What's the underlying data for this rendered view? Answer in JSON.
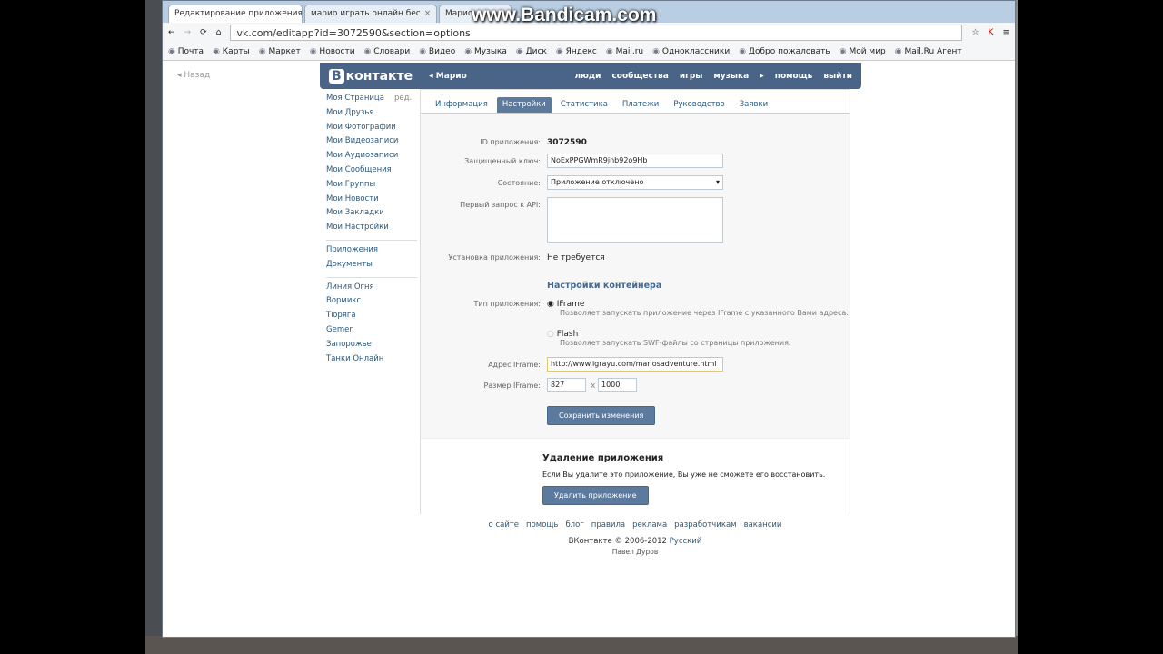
{
  "browser": {
    "tabs": [
      {
        "title": "Редактирование приложения",
        "icon": "vk-icon"
      },
      {
        "title": "марио играть онлайн бес",
        "icon": "loading-icon"
      },
      {
        "title": "Марио",
        "icon": "mario-icon"
      }
    ],
    "watermark": "www.Bandicam.com",
    "url": "vk.com/editapp?id=3072590&section=options",
    "bookmarks": [
      "Почта",
      "Карты",
      "Маркет",
      "Новости",
      "Словари",
      "Видео",
      "Музыка",
      "Диск",
      "Яндекс",
      "Mail.ru",
      "Одноклассники",
      "Добро пожаловать",
      "Мой мир",
      "Mail.Ru Агент"
    ]
  },
  "page": {
    "back": "Назад",
    "logo": "контакте",
    "logo_letter": "В",
    "user": "Марио",
    "nav": [
      "люди",
      "сообщества",
      "игры",
      "музыка",
      "▸",
      "помощь",
      "выйти"
    ],
    "sidebar": {
      "edit": "ред.",
      "group1": [
        "Моя Страница",
        "Мои Друзья",
        "Мои Фотографии",
        "Мои Видеозаписи",
        "Мои Аудиозаписи",
        "Мои Сообщения",
        "Мои Группы",
        "Мои Новости",
        "Мои Закладки",
        "Мои Настройки"
      ],
      "group2": [
        "Приложения",
        "Документы"
      ],
      "group3": [
        "Линия Огня",
        "Вормикс",
        "Тюряга",
        "Gemer",
        "Запорожье",
        "Танки Онлайн"
      ]
    },
    "tabs": [
      "Информация",
      "Настройки",
      "Статистика",
      "Платежи",
      "Руководство",
      "Заявки"
    ],
    "form": {
      "id_label": "ID приложения:",
      "id_value": "3072590",
      "key_label": "Защищенный ключ:",
      "key_value": "NoExPPGWmR9jnb92o9Hb",
      "state_label": "Состояние:",
      "state_value": "Приложение отключено",
      "api_label": "Первый запрос к API:",
      "api_value": "",
      "install_label": "Установка приложения:",
      "install_value": "Не требуется",
      "container_title": "Настройки контейнера",
      "type_label": "Тип приложения:",
      "iframe": "IFrame",
      "iframe_desc": "Позволяет запускать приложение через IFrame с указанного Вами адреса.",
      "flash": "Flash",
      "flash_desc": "Позволяет запускать SWF-файлы со страницы приложения.",
      "address_label": "Адрес IFrame:",
      "address_value": "http://www.igrayu.com/mariosadventure.html",
      "size_label": "Размер IFrame:",
      "width": "827",
      "sep": "x",
      "height": "1000",
      "save": "Сохранить изменения"
    },
    "delete": {
      "title": "Удаление приложения",
      "text": "Если Вы удалите это приложение, Вы уже не сможете его восстановить.",
      "button": "Удалить приложение"
    },
    "footer": {
      "links": [
        "о сайте",
        "помощь",
        "блог",
        "правила",
        "реклама",
        "разработчикам",
        "вакансии"
      ],
      "copy": "ВКонтакте © 2006-2012",
      "lang": "Русский",
      "author": "Павел Дуров"
    }
  }
}
